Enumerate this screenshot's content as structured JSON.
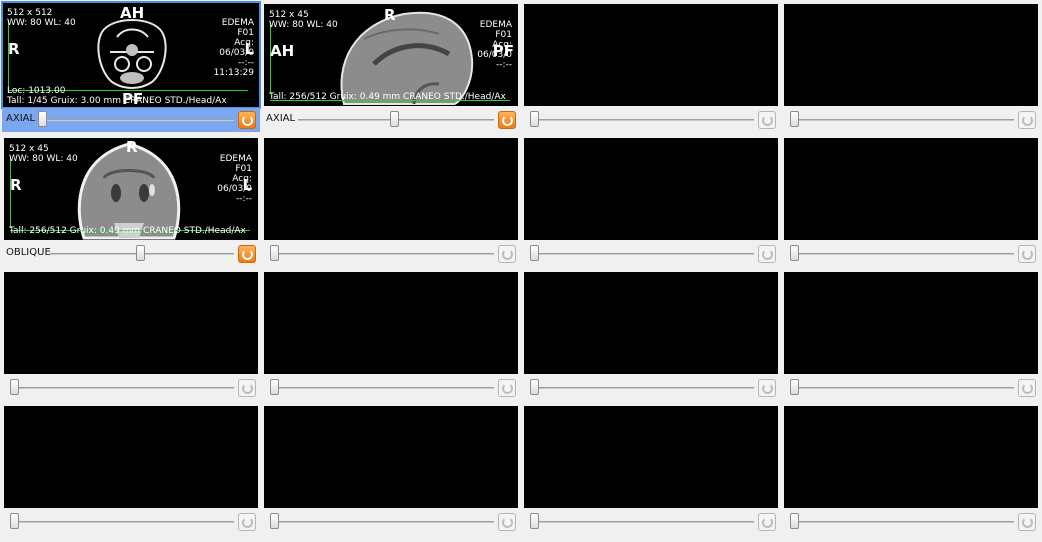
{
  "viewers": [
    {
      "id": "v1",
      "selected": true,
      "label": "AXIAL",
      "sync_active": true,
      "overlay": {
        "top_left": [
          "512 x 512",
          "WW: 80 WL: 40"
        ],
        "top_right": [
          "EDEMA",
          "F01",
          "Acq:",
          "06/03/0",
          "--:--",
          "11:13:29"
        ],
        "orient_top": "AH",
        "orient_bottom": "PF",
        "orient_left": "R",
        "orient_right": "L",
        "bottom_left": [
          "Loc: 1013.00",
          "Tall: 1/45 Gruix: 3.00 mm CRANEO STD./Head/Ax"
        ]
      }
    },
    {
      "id": "v2",
      "selected": false,
      "label": "AXIAL",
      "sync_active": true,
      "overlay": {
        "top_left": [
          "512 x 45",
          "WW: 80 WL: 40"
        ],
        "top_right": [
          "EDEMA",
          "F01",
          "Acq:",
          "06/03/0",
          "--:--"
        ],
        "orient_top": "R",
        "orient_left": "AH",
        "orient_right": "PF",
        "bottom_left": [
          "Tall: 256/512 Gruix: 0.49 mm CRANEO STD./Head/Ax"
        ]
      }
    },
    {
      "id": "v5",
      "selected": false,
      "label": "OBLIQUE",
      "sync_active": true,
      "overlay": {
        "top_left": [
          "512 x 45",
          "WW: 80 WL: 40"
        ],
        "top_right": [
          "EDEMA",
          "F01",
          "Acq:",
          "06/03/0",
          "--:--"
        ],
        "orient_top": "R",
        "orient_left": "R",
        "orient_right": "L",
        "bottom_left": [
          "Tall: 256/512 Gruix: 0.49 mm CRANEO STD./Head/Ax"
        ]
      }
    }
  ],
  "slider_positions": {
    "v1": 0.0,
    "v2": 0.5,
    "v5": 0.5,
    "empty": 0.0
  }
}
